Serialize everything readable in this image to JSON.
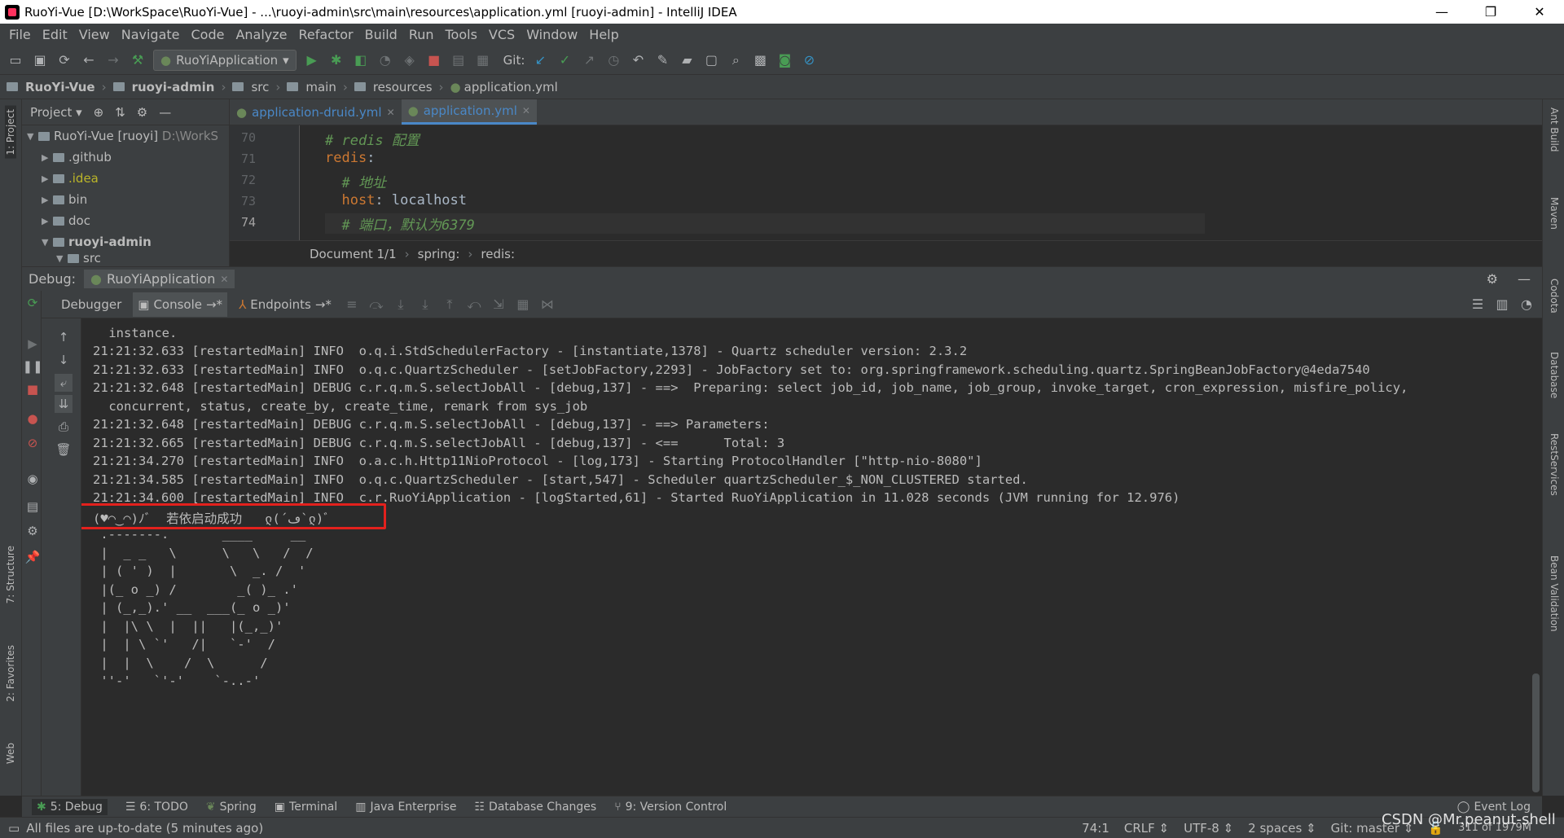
{
  "window": {
    "title": "RuoYi-Vue [D:\\WorkSpace\\RuoYi-Vue] - ...\\ruoyi-admin\\src\\main\\resources\\application.yml [ruoyi-admin] - IntelliJ IDEA",
    "minimize": "—",
    "restore": "❐",
    "close": "✕"
  },
  "menu": [
    "File",
    "Edit",
    "View",
    "Navigate",
    "Code",
    "Analyze",
    "Refactor",
    "Build",
    "Run",
    "Tools",
    "VCS",
    "Window",
    "Help"
  ],
  "toolbar": {
    "run_config": "RuoYiApplication",
    "git_label": "Git:"
  },
  "breadcrumb": [
    "RuoYi-Vue",
    "ruoyi-admin",
    "src",
    "main",
    "resources",
    "application.yml"
  ],
  "project": {
    "title": "Project",
    "items": [
      {
        "label": "RuoYi-Vue [ruoyi]",
        "extra": "D:\\WorkS",
        "expanded": true
      },
      {
        "label": ".github"
      },
      {
        "label": ".idea"
      },
      {
        "label": "bin"
      },
      {
        "label": "doc"
      },
      {
        "label": "ruoyi-admin",
        "expanded": true
      },
      {
        "label": "src"
      }
    ]
  },
  "editor": {
    "tabs": [
      {
        "label": "application-druid.yml",
        "active": false
      },
      {
        "label": "application.yml",
        "active": true
      }
    ],
    "lines": [
      {
        "num": "70",
        "text": "# redis 配置"
      },
      {
        "num": "71",
        "key": "redis",
        "rest": ":"
      },
      {
        "num": "72",
        "text": "  # 地址"
      },
      {
        "num": "73",
        "key": "  host",
        "rest": ": localhost"
      },
      {
        "num": "74",
        "text": "  # 端口，默认为6379"
      }
    ],
    "crumbs": [
      "Document 1/1",
      "spring:",
      "redis:"
    ]
  },
  "debug": {
    "label": "Debug:",
    "session": "RuoYiApplication",
    "tabs": [
      "Debugger",
      "Console",
      "Endpoints"
    ]
  },
  "console": {
    "lines": [
      " instance.",
      "21:21:32.633 [restartedMain] INFO  o.q.i.StdSchedulerFactory - [instantiate,1378] - Quartz scheduler version: 2.3.2",
      "21:21:32.633 [restartedMain] INFO  o.q.c.QuartzScheduler - [setJobFactory,2293] - JobFactory set to: org.springframework.scheduling.quartz.SpringBeanJobFactory@4eda7540",
      "21:21:32.648 [restartedMain] DEBUG c.r.q.m.S.selectJobAll - [debug,137] - ==>  Preparing: select job_id, job_name, job_group, invoke_target, cron_expression, misfire_policy,",
      " concurrent, status, create_by, create_time, remark from sys_job",
      "21:21:32.648 [restartedMain] DEBUG c.r.q.m.S.selectJobAll - [debug,137] - ==> Parameters: ",
      "21:21:32.665 [restartedMain] DEBUG c.r.q.m.S.selectJobAll - [debug,137] - <==      Total: 3",
      "21:21:34.270 [restartedMain] INFO  o.a.c.h.Http11NioProtocol - [log,173] - Starting ProtocolHandler [\"http-nio-8080\"]",
      "21:21:34.585 [restartedMain] INFO  o.q.c.QuartzScheduler - [start,547] - Scheduler quartzScheduler_$_NON_CLUSTERED started.",
      "21:21:34.600 [restartedMain] INFO  c.r.RuoYiApplication - [logStarted,61] - Started RuoYiApplication in 11.028 seconds (JVM running for 12.976)",
      "(♥◠‿◠)ﾉﾞ  若依启动成功   ლ(´ڡ`ლ)ﾞ  ",
      " .-------.       ____     __        ",
      " |  _ _   \\      \\   \\   /  /    ",
      " | ( ' )  |       \\  _. /  '       ",
      " |(_ o _) /        _( )_ .'         ",
      " | (_,_).' __  ___(_ o _)'          ",
      " |  |\\ \\  |  ||   |(_,_)'         ",
      " |  | \\ `'   /|   `-'  /           ",
      " |  |  \\    /  \\      /           ",
      " ''-'   `'-'    `-..-'              "
    ]
  },
  "bottom_tabs": [
    {
      "key": "5",
      "label": "5: Debug",
      "active": true
    },
    {
      "key": "6",
      "label": "6: TODO"
    },
    {
      "label": "Spring"
    },
    {
      "label": "Terminal"
    },
    {
      "label": "Java Enterprise"
    },
    {
      "label": "Database Changes"
    },
    {
      "key": "9",
      "label": "9: Version Control"
    },
    {
      "label": "Event Log"
    }
  ],
  "status": {
    "message": "All files are up-to-date (5 minutes ago)",
    "position": "74:1",
    "line_sep": "CRLF",
    "encoding": "UTF-8",
    "indent": "2 spaces",
    "branch": "Git: master",
    "memory": "311 of 1979M"
  },
  "right_tools": [
    "Ant Build",
    "Maven",
    "Codota",
    "Database",
    "RestServices",
    "Bean Validation"
  ],
  "left_tools": [
    "1: Project",
    "7: Structure",
    "2: Favorites",
    "Web"
  ],
  "watermark": "CSDN @Mr.peanut-shell"
}
